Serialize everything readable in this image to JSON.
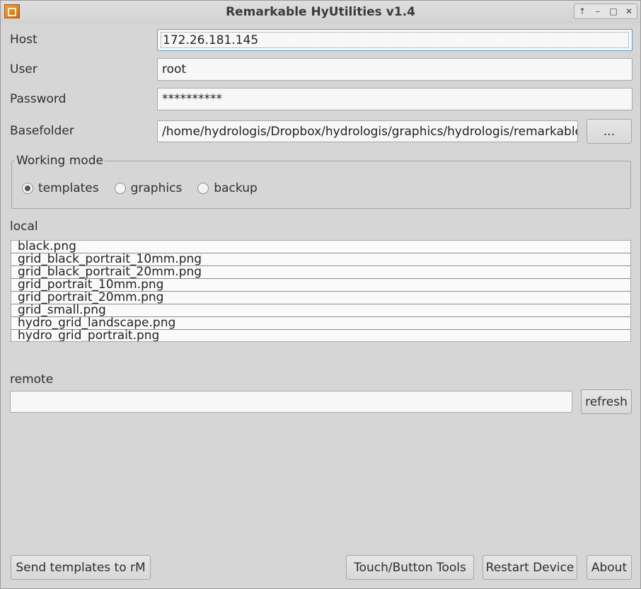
{
  "window": {
    "title": "Remarkable HyUtilities v1.4",
    "controls": [
      "↑",
      "–",
      "□",
      "✕"
    ]
  },
  "form": {
    "host_label": "Host",
    "host_value": "172.26.181.145",
    "user_label": "User",
    "user_value": "root",
    "password_label": "Password",
    "password_value": "**********",
    "basefolder_label": "Basefolder",
    "basefolder_value": "/home/hydrologis/Dropbox/hydrologis/graphics/hydrologis/remarkable",
    "browse_label": "..."
  },
  "working_mode": {
    "title": "Working mode",
    "options": [
      {
        "label": "templates",
        "checked": true
      },
      {
        "label": "graphics",
        "checked": false
      },
      {
        "label": "backup",
        "checked": false
      }
    ]
  },
  "local": {
    "label": "local",
    "items": [
      "black.png",
      "grid_black_portrait_10mm.png",
      "grid_black_portrait_20mm.png",
      "grid_portrait_10mm.png",
      "grid_portrait_20mm.png",
      "grid_small.png",
      "hydro_grid_landscape.png",
      "hydro_grid_portrait.png"
    ]
  },
  "remote": {
    "label": "remote",
    "value": "",
    "refresh_label": "refresh"
  },
  "footer": {
    "send_label": "Send templates to rM",
    "touch_label": "Touch/Button Tools",
    "restart_label": "Restart Device",
    "about_label": "About"
  }
}
